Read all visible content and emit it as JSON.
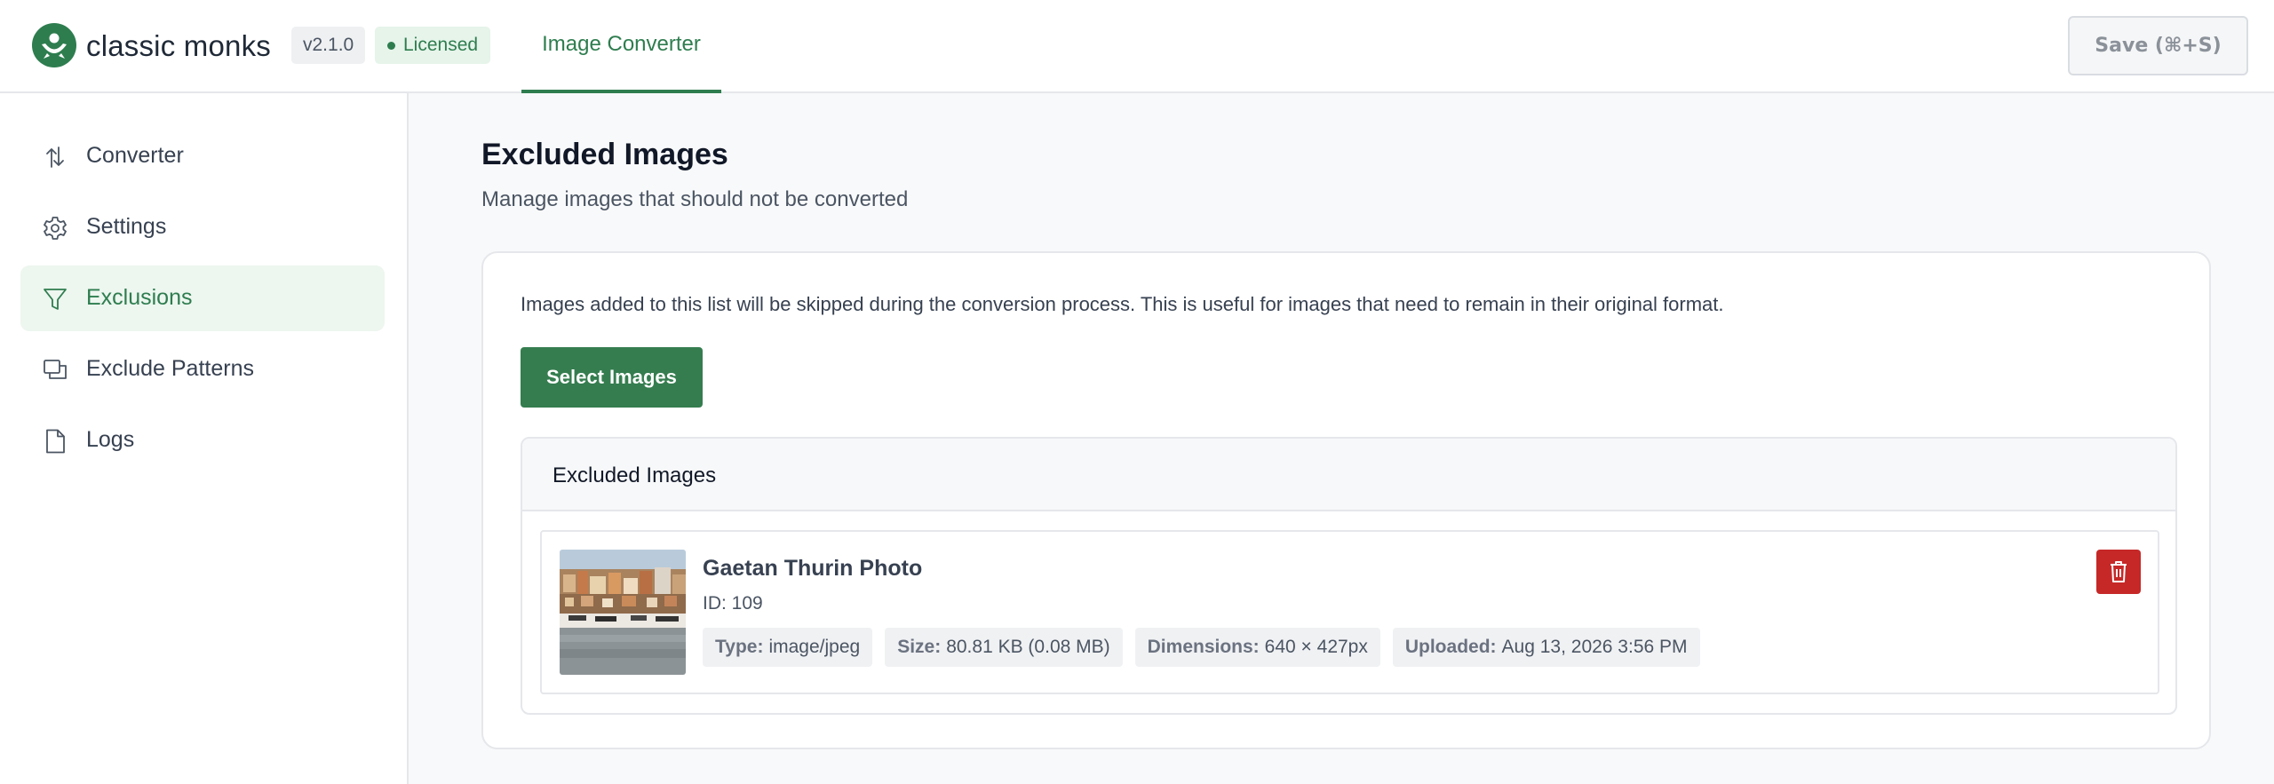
{
  "header": {
    "brand": "classic monks",
    "version": "v2.1.0",
    "license_status": "Licensed",
    "active_tab": "Image Converter",
    "save_label": "Save (⌘+S)"
  },
  "sidebar": {
    "items": [
      {
        "label": "Converter",
        "icon": "converter-arrows-icon"
      },
      {
        "label": "Settings",
        "icon": "gear-icon"
      },
      {
        "label": "Exclusions",
        "icon": "filter-icon",
        "active": true
      },
      {
        "label": "Exclude Patterns",
        "icon": "copy-icon"
      },
      {
        "label": "Logs",
        "icon": "file-icon"
      }
    ]
  },
  "main": {
    "title": "Excluded Images",
    "subtitle": "Manage images that should not be converted",
    "description": "Images added to this list will be skipped during the conversion process. This is useful for images that need to remain in their original format.",
    "select_button": "Select Images",
    "panel_title": "Excluded Images",
    "images": [
      {
        "title": "Gaetan Thurin Photo",
        "id": "ID: 109",
        "meta": [
          {
            "key": "Type:",
            "value": "image/jpeg"
          },
          {
            "key": "Size:",
            "value": "80.81 KB (0.08 MB)"
          },
          {
            "key": "Dimensions:",
            "value": "640 × 427px"
          },
          {
            "key": "Uploaded:",
            "value": "Aug 13, 2026 3:56 PM"
          }
        ]
      }
    ]
  },
  "colors": {
    "accent": "#2e7d4f",
    "button": "#357d4f",
    "danger": "#c62828"
  }
}
